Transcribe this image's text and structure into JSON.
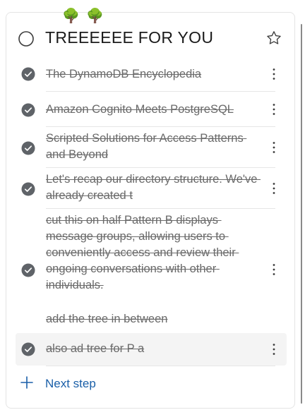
{
  "header": {
    "emoji_left": "🌳",
    "emoji_right": "🌳",
    "title": "TREEEEEE FOR YOU",
    "complete_icon": "circle-outline-icon",
    "favorite_icon": "star-outline-icon"
  },
  "steps": [
    {
      "label": "The DynamoDB Encyclopedia",
      "completed": true,
      "icon": "check-circle-icon",
      "menu_icon": "more-vertical-icon"
    },
    {
      "label": "Amazon Cognito Meets PostgreSQL",
      "completed": true,
      "icon": "check-circle-icon",
      "menu_icon": "more-vertical-icon"
    },
    {
      "label": "Scripted Solutions for Access Patterns and Beyond",
      "completed": true,
      "icon": "check-circle-icon",
      "menu_icon": "more-vertical-icon"
    },
    {
      "label": "Let's recap our directory structure. We've already created t",
      "completed": true,
      "icon": "check-circle-icon",
      "menu_icon": "more-vertical-icon"
    },
    {
      "label": "cut this on half Pattern B displays message groups, allowing users to conveniently access and review their ongoing conversations with other individuals.",
      "label_extra": "add the tree in between",
      "completed": true,
      "icon": "check-circle-icon",
      "menu_icon": "more-vertical-icon"
    },
    {
      "label": "also ad tree for P a",
      "completed": true,
      "icon": "check-circle-icon",
      "menu_icon": "more-vertical-icon"
    }
  ],
  "add_step": {
    "label": "Next step",
    "icon": "plus-icon"
  },
  "colors": {
    "accent": "#1a5fa8",
    "check_fill": "#5f6368",
    "text_done": "#6a6a6a",
    "title": "#1b1b1b"
  }
}
